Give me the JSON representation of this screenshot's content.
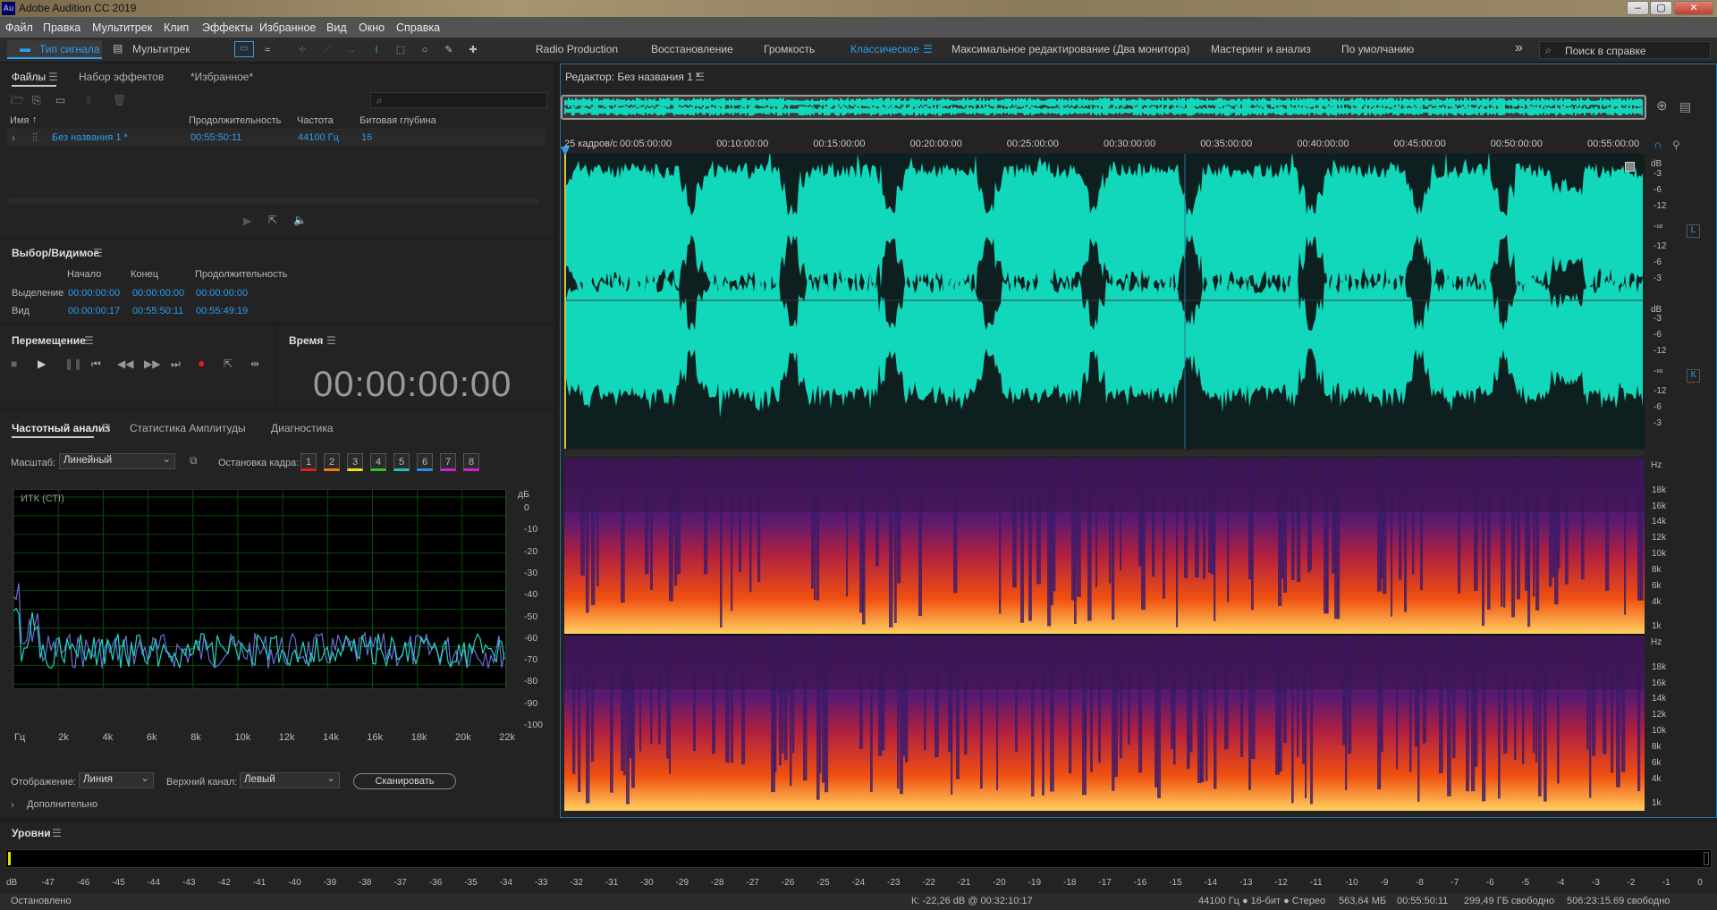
{
  "window": {
    "title": "Adobe Audition CC 2019",
    "logo": "Au"
  },
  "menu": [
    "Файл",
    "Правка",
    "Мультитрек",
    "Клип",
    "Эффекты",
    "Избранное",
    "Вид",
    "Окно",
    "Справка"
  ],
  "toolbar": {
    "waveform_label": "Тип сигнала",
    "multitrack_label": "Мультитрек",
    "workspaces": [
      "Radio Production",
      "Восстановление",
      "Громкость",
      "Классическое",
      "Максимальное редактирование (Два монитора)",
      "Мастеринг и анализ",
      "По умолчанию"
    ],
    "active_workspace": "Классическое",
    "search_placeholder": "Поиск в справке"
  },
  "files_panel": {
    "tabs": [
      "Файлы",
      "Набор эффектов",
      "*Избранное*"
    ],
    "columns": [
      "Имя",
      "Продолжительность",
      "Частота",
      "Битовая глубина"
    ],
    "rows": [
      {
        "name": "Без названия 1 *",
        "duration": "00:55:50:11",
        "rate": "44100 Гц",
        "depth": "16"
      }
    ]
  },
  "selection_panel": {
    "title": "Выбор/Видимое",
    "col_start": "Начало",
    "col_end": "Конец",
    "col_duration": "Продолжительность",
    "selection_label": "Выделение",
    "view_label": "Вид",
    "selection": [
      "00:00:00:00",
      "00:00:00:00",
      "00:00:00:00"
    ],
    "view": [
      "00:00:00:17",
      "00:55:50:11",
      "00:55:49:19"
    ]
  },
  "transport_panel": {
    "title": "Перемещение"
  },
  "time_panel": {
    "title": "Время",
    "time": "00:00:00:00"
  },
  "freq_panel": {
    "tabs": [
      "Частотный анализ",
      "Статистика Амплитуды",
      "Диагностика"
    ],
    "scale_label": "Масштаб:",
    "scale_value": "Линейный",
    "freeze_label": "Остановка кадра:",
    "freeze_keys": [
      "1",
      "2",
      "3",
      "4",
      "5",
      "6",
      "7",
      "8"
    ],
    "freeze_colors": [
      "#e02020",
      "#f07a10",
      "#f0e020",
      "#30c030",
      "#20c0c0",
      "#2090f0",
      "#d020d0",
      "#d020d0"
    ],
    "plot_label": "ИТК (СТI)",
    "db_unit": "дБ",
    "db_ticks": [
      "0",
      "-10",
      "-20",
      "-30",
      "-40",
      "-50",
      "-60",
      "-70",
      "-80",
      "-90",
      "-100"
    ],
    "freq_ticks": [
      "Гц",
      "2k",
      "4k",
      "6k",
      "8k",
      "10k",
      "12k",
      "14k",
      "16k",
      "18k",
      "20k",
      "22k"
    ],
    "display_label": "Отображение:",
    "display_value": "Линия",
    "channel_label": "Верхний канал:",
    "channel_value": "Левый",
    "scan_button": "Сканировать",
    "advanced": "Дополнительно"
  },
  "editor": {
    "title": "Редактор: Без названия 1 *",
    "ruler": [
      "25 кадров/с",
      "00:05:00:00",
      "00:10:00:00",
      "00:15:00:00",
      "00:20:00:00",
      "00:25:00:00",
      "00:30:00:00",
      "00:35:00:00",
      "00:40:00:00",
      "00:45:00:00",
      "00:50:00:00",
      "00:55:00:00"
    ],
    "db_label": "dB",
    "db_scale": [
      "-3",
      "-6",
      "-12",
      "-∞",
      "-12",
      "-6",
      "-3"
    ],
    "hz_label": "Hz",
    "hz_scale": [
      "18k",
      "16k",
      "14k",
      "12k",
      "10k",
      "8k",
      "6k",
      "4k",
      "1k"
    ],
    "left_channel": "L",
    "right_channel": "К"
  },
  "levels": {
    "title": "Уровни",
    "scale": [
      "dB",
      "-47",
      "-46",
      "-45",
      "-44",
      "-43",
      "-42",
      "-41",
      "-40",
      "-39",
      "-38",
      "-37",
      "-36",
      "-35",
      "-34",
      "-33",
      "-32",
      "-31",
      "-30",
      "-29",
      "-28",
      "-27",
      "-26",
      "-25",
      "-24",
      "-23",
      "-22",
      "-21",
      "-20",
      "-19",
      "-18",
      "-17",
      "-16",
      "-15",
      "-14",
      "-13",
      "-12",
      "-11",
      "-10",
      "-9",
      "-8",
      "-7",
      "-6",
      "-5",
      "-4",
      "-3",
      "-2",
      "-1",
      "0"
    ]
  },
  "status": {
    "state": "Остановлено",
    "cursor": "К: -22,26 dB @ 00:32:10:17",
    "format": "44100 Гц ● 16-бит ● Стерео",
    "size": "563,64 МБ",
    "duration": "00:55:50:11",
    "free": "299,49 ГБ свободно",
    "free_time": "506:23:15.69 свободно"
  },
  "colors": {
    "accent": "#2d9ef0",
    "waveform": "#12d8bb",
    "record": "#e02020"
  }
}
